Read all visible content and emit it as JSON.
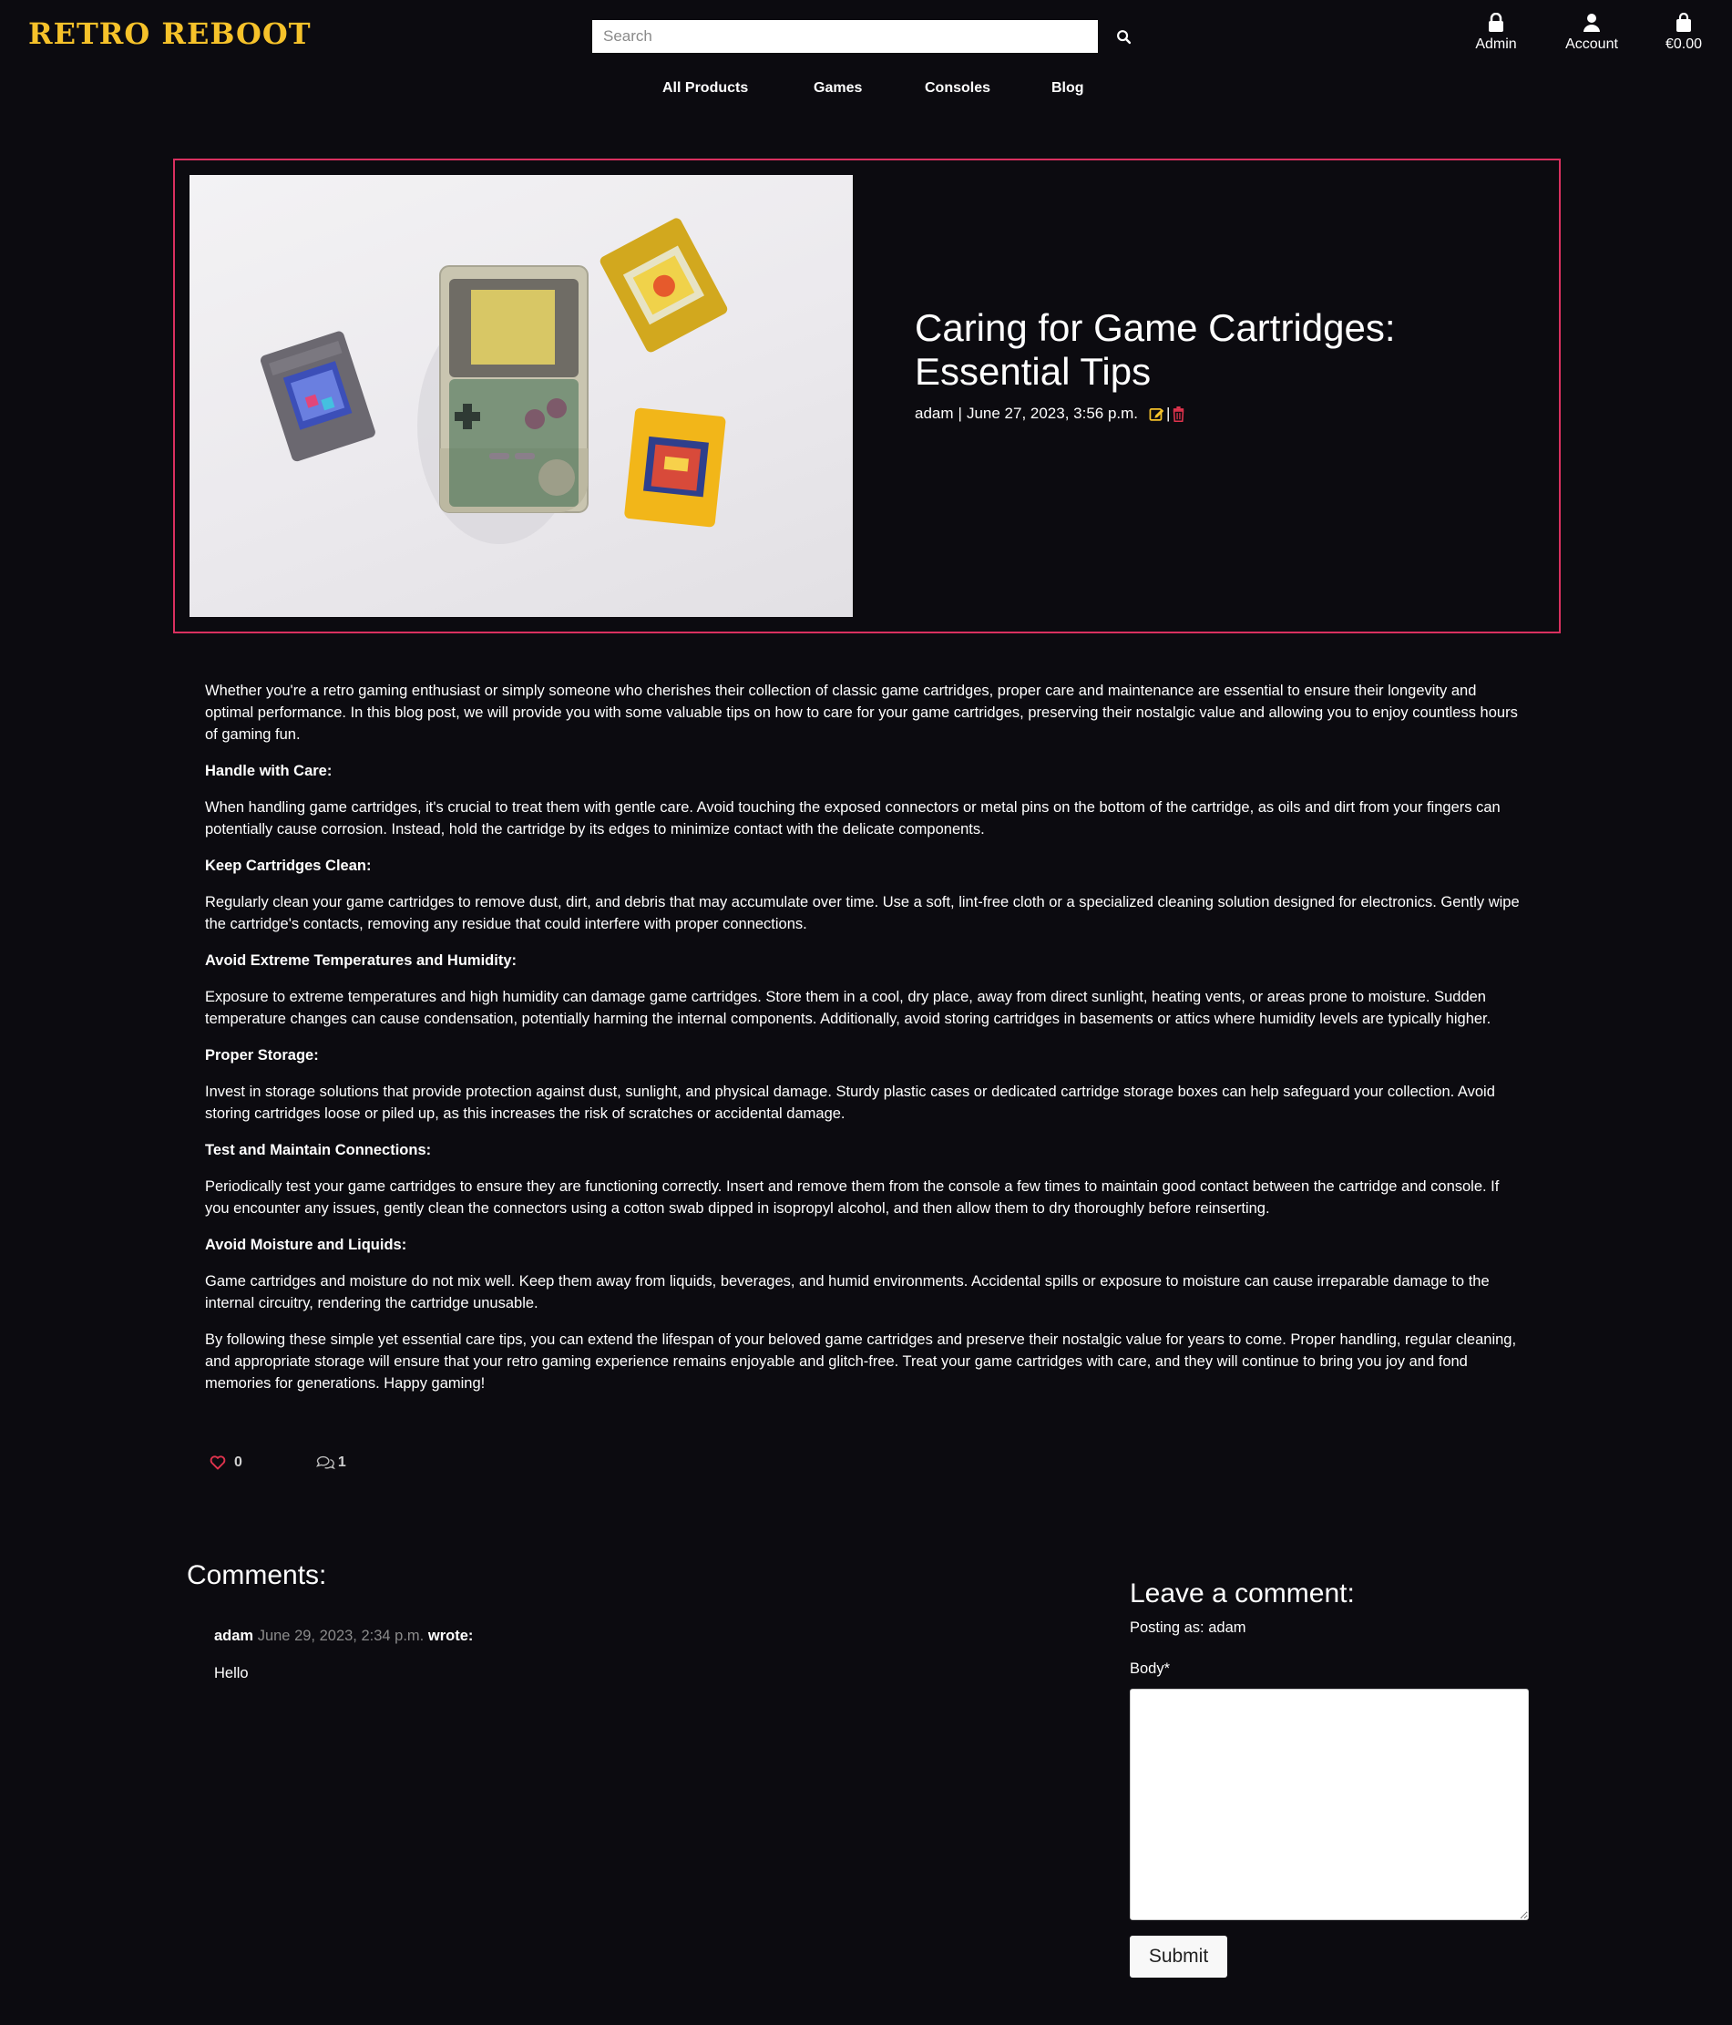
{
  "header": {
    "brand": "RETRO REBOOT",
    "search_placeholder": "Search",
    "admin_label": "Admin",
    "account_label": "Account",
    "cart_total": "€0.00"
  },
  "nav": {
    "items": [
      "All Products",
      "Games",
      "Consoles",
      "Blog"
    ]
  },
  "post": {
    "title": "Caring for Game Cartridges: Essential Tips",
    "author": "adam",
    "separator": "|",
    "date": "June 27, 2023, 3:56 p.m.",
    "intro": "Whether you're a retro gaming enthusiast or simply someone who cherishes their collection of classic game cartridges, proper care and maintenance are essential to ensure their longevity and optimal performance. In this blog post, we will provide you with some valuable tips on how to care for your game cartridges, preserving their nostalgic value and allowing you to enjoy countless hours of gaming fun.",
    "sections": [
      {
        "heading": "Handle with Care:",
        "text": "When handling game cartridges, it's crucial to treat them with gentle care. Avoid touching the exposed connectors or metal pins on the bottom of the cartridge, as oils and dirt from your fingers can potentially cause corrosion. Instead, hold the cartridge by its edges to minimize contact with the delicate components."
      },
      {
        "heading": "Keep Cartridges Clean:",
        "text": "Regularly clean your game cartridges to remove dust, dirt, and debris that may accumulate over time. Use a soft, lint-free cloth or a specialized cleaning solution designed for electronics. Gently wipe the cartridge's contacts, removing any residue that could interfere with proper connections."
      },
      {
        "heading": "Avoid Extreme Temperatures and Humidity:",
        "text": "Exposure to extreme temperatures and high humidity can damage game cartridges. Store them in a cool, dry place, away from direct sunlight, heating vents, or areas prone to moisture. Sudden temperature changes can cause condensation, potentially harming the internal components. Additionally, avoid storing cartridges in basements or attics where humidity levels are typically higher."
      },
      {
        "heading": "Proper Storage:",
        "text": "Invest in storage solutions that provide protection against dust, sunlight, and physical damage. Sturdy plastic cases or dedicated cartridge storage boxes can help safeguard your collection. Avoid storing cartridges loose or piled up, as this increases the risk of scratches or accidental damage."
      },
      {
        "heading": "Test and Maintain Connections:",
        "text": "Periodically test your game cartridges to ensure they are functioning correctly. Insert and remove them from the console a few times to maintain good contact between the cartridge and console. If you encounter any issues, gently clean the connectors using a cotton swab dipped in isopropyl alcohol, and then allow them to dry thoroughly before reinserting."
      },
      {
        "heading": "Avoid Moisture and Liquids:",
        "text": "Game cartridges and moisture do not mix well. Keep them away from liquids, beverages, and humid environments. Accidental spills or exposure to moisture can cause irreparable damage to the internal circuitry, rendering the cartridge unusable."
      }
    ],
    "conclusion": "By following these simple yet essential care tips, you can extend the lifespan of your beloved game cartridges and preserve their nostalgic value for years to come. Proper handling, regular cleaning, and appropriate storage will ensure that your retro gaming experience remains enjoyable and glitch-free. Treat your game cartridges with care, and they will continue to bring you joy and fond memories for generations. Happy gaming!",
    "likes": "0",
    "comment_count": "1"
  },
  "comments": {
    "title": "Comments:",
    "items": [
      {
        "author": "adam",
        "date": "June 29, 2023, 2:34 p.m.",
        "wrote": "wrote:",
        "body": "Hello"
      }
    ]
  },
  "comment_form": {
    "title": "Leave a comment:",
    "posting_as": "Posting as: adam",
    "body_label": "Body*",
    "body_value": "",
    "submit_label": "Submit"
  },
  "colors": {
    "background": "#0c0b10",
    "brand": "#f6c22a",
    "hero_border": "#d9305f",
    "edit_icon": "#f6c22a",
    "delete_icon": "#e0334d",
    "like_icon": "#e0334d"
  },
  "icons": {
    "search": "search-icon",
    "admin": "lock-icon",
    "account": "user-icon",
    "cart": "shopping-bag-icon",
    "edit": "edit-icon",
    "delete": "trash-icon",
    "like": "heart-icon",
    "comments": "comments-icon"
  }
}
